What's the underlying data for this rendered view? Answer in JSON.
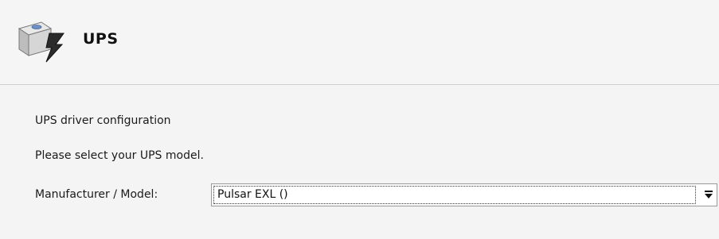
{
  "header": {
    "title": "UPS",
    "icon": "ups-device-icon"
  },
  "content": {
    "heading": "UPS driver configuration",
    "instruction": "Please select your UPS model.",
    "model_label": "Manufacturer / Model:",
    "model_value": "Pulsar EXL ()",
    "dropdown_icon": "dropdown-arrow-icon"
  }
}
